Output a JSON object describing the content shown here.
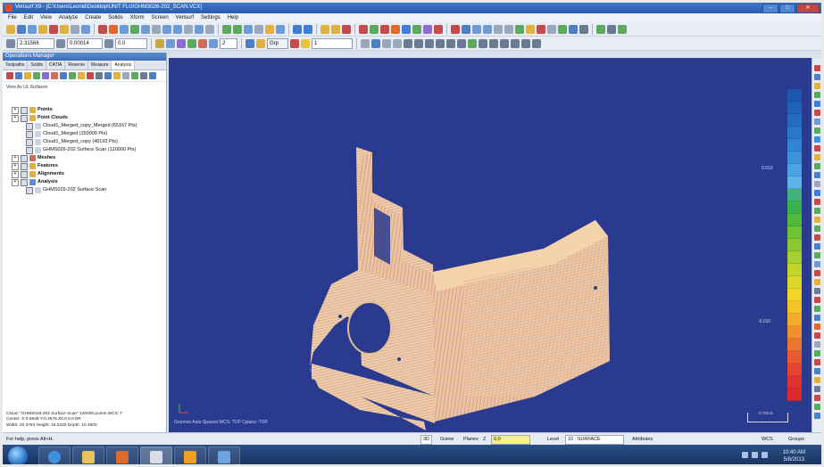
{
  "app": {
    "title": "Verisurf X9 - [C:\\Users\\Leonid\\Desktop\\UNIT FLU\\GHMS026-202_SCAN.VCX]",
    "window_buttons": [
      "–",
      "□",
      "✕"
    ]
  },
  "menu": [
    "File",
    "Edit",
    "View",
    "Analyze",
    "Create",
    "Solids",
    "Xform",
    "Screen",
    "Verisurf",
    "Settings",
    "Help"
  ],
  "toolbar": {
    "field_1": "2.31566",
    "field_2": "0.00014",
    "field_3": "0.0",
    "field_4": "2",
    "group_button": "Grp",
    "level_field": "1"
  },
  "operations_manager": {
    "title": "Operations Manager",
    "tabs": [
      "Toolpaths",
      "Solids",
      "CATIA",
      "Reverse",
      "Measure",
      "Analysis"
    ],
    "active_tab": "Analysis",
    "view_as": "View As UL Surfaces",
    "tree": [
      {
        "label": "Points",
        "level": 0,
        "bold": true
      },
      {
        "label": "Point Clouds",
        "level": 0,
        "bold": true
      },
      {
        "label": "Cloud1_Merged_copy_Merged (65167 Pts)",
        "level": 1,
        "bold": false
      },
      {
        "label": "Cloud1_Merged (150000 Pts)",
        "level": 1,
        "bold": false
      },
      {
        "label": "Cloud1_Merged_copy (48193 Pts)",
        "level": 1,
        "bold": false
      },
      {
        "label": "GHMS026-202 Surface Scan (120000 Pts)",
        "level": 1,
        "bold": false
      },
      {
        "label": "Meshes",
        "level": 0,
        "bold": true
      },
      {
        "label": "Features",
        "level": 0,
        "bold": true
      },
      {
        "label": "Alignments",
        "level": 0,
        "bold": true
      },
      {
        "label": "Analysis",
        "level": 0,
        "bold": true
      },
      {
        "label": "GHMS026-202 Surface Scan",
        "level": 1,
        "bold": false
      }
    ],
    "info_lines": [
      "Cloud: \"GHMS026-202 Surface Scan\" 120000 points    WCS: T",
      "Center: X-0.6838 Y-0.4675 Z0.0 0.0 ER",
      "Width: 20.3763 Height: 16.0220 Depth: 10.4900"
    ]
  },
  "viewport": {
    "background": "#2a3b8f",
    "cloud_color": "#f3cfa3",
    "bottom_label": "Gnomon  Auto Spaced   WCS: TOP   Cplane: TOP",
    "scale_labels": [
      "0.010",
      "-0.010"
    ],
    "scalebar_label": "0.784 in",
    "scale_colors": [
      "#1e57b0",
      "#2062b8",
      "#236dc0",
      "#2979c9",
      "#3086d2",
      "#3b94da",
      "#4aa3e2",
      "#5bb3ea",
      "#3fb37a",
      "#37b34a",
      "#4fba3a",
      "#6dc236",
      "#89c933",
      "#a6cf31",
      "#c2d52e",
      "#dcd82b",
      "#f2d42a",
      "#f6c22a",
      "#f5ab2c",
      "#f28f2e",
      "#ee752f",
      "#ea5a30",
      "#e54431",
      "#e03231",
      "#db2a2f"
    ]
  },
  "status": {
    "help_text": "For help, press Alt+H.",
    "mode": "3D",
    "gview": "Gview",
    "planes": "Planes",
    "z_label": "Z",
    "z_value": "0.0",
    "level_label": "Level",
    "level_value": "10 : SURFACE",
    "attributes": "Attributes",
    "wcs": "WCS",
    "groups": "Groups"
  },
  "taskbar": {
    "time": "10:40 AM",
    "date": "5/8/2013"
  }
}
